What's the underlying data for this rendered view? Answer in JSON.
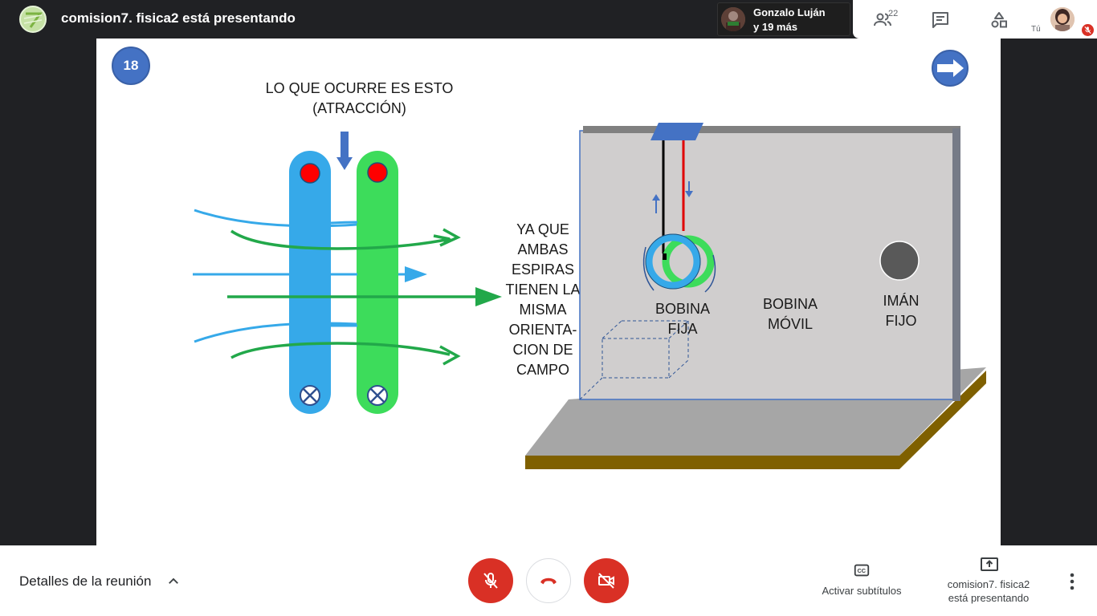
{
  "header": {
    "presenting_title": "comision7. fisica2 está presentando",
    "participants_chip": {
      "line1": "Gonzalo Luján",
      "line2": "y 19 más"
    },
    "people_count": "22",
    "self_label": "Tú"
  },
  "slide": {
    "number": "18",
    "heading_line1": "LO QUE OCURRE ES ESTO",
    "heading_line2": "(ATRACCIÓN)",
    "explanation_lines": [
      "YA QUE",
      "AMBAS",
      "ESPIRAS",
      "TIENEN LA",
      "MISMA",
      "ORIENTA-",
      "CION DE",
      "CAMPO"
    ],
    "label_bobina_fija": [
      "BOBINA",
      "FIJA"
    ],
    "label_bobina_movil": [
      "BOBINA",
      "MÓVIL"
    ],
    "label_iman_fijo": [
      "IMÁN",
      "FIJO"
    ],
    "colors": {
      "blue_loop": "#36a9e9",
      "green_loop": "#3ddc5b",
      "dot_red": "#ff0000",
      "panel": "#d0cece",
      "base_edge": "#7f6000"
    }
  },
  "bottom": {
    "meeting_details": "Detalles de la reunión",
    "captions_label": "Activar subtítulos",
    "presenting_line1": "comision7. fisica2",
    "presenting_line2": "está presentando"
  },
  "icons": [
    "people-icon",
    "chat-icon",
    "activities-icon",
    "mic-off-icon",
    "hang-up-icon",
    "camera-off-icon",
    "captions-icon",
    "present-icon",
    "more-vert-icon",
    "chevron-up-icon"
  ]
}
